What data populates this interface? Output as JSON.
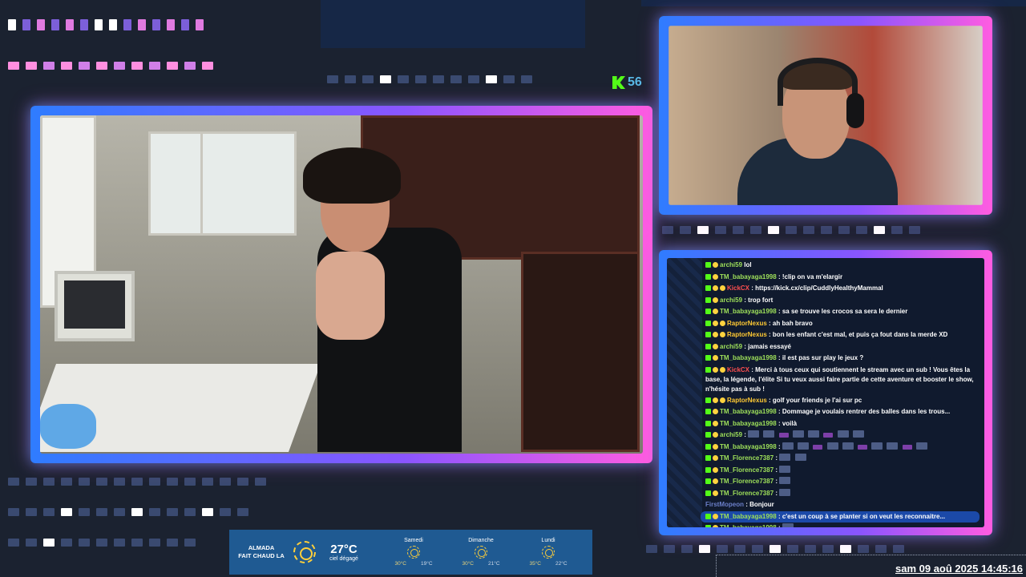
{
  "viewers": {
    "platform_icon": "kick-logo-icon",
    "count": "56"
  },
  "chat": {
    "messages": [
      {
        "user": "archi59",
        "color": "#9ee05a",
        "text": "lol",
        "badges": [
          "k",
          "s"
        ]
      },
      {
        "user": "TM_babayaga1998",
        "color": "#9ee05a",
        "text": ": !clip on va m'elargir",
        "badges": [
          "k",
          "s"
        ]
      },
      {
        "user": "KickCX",
        "color": "#ff4f4f",
        "text": ": https://kick.cx/clip/CuddlyHealthyMammal",
        "badges": [
          "k",
          "s",
          "s"
        ]
      },
      {
        "user": "archi59",
        "color": "#9ee05a",
        "text": ": trop fort",
        "badges": [
          "k",
          "s"
        ]
      },
      {
        "user": "TM_babayaga1998",
        "color": "#9ee05a",
        "text": ": sa se trouve les crocos sa sera le dernier",
        "badges": [
          "k",
          "s"
        ]
      },
      {
        "user": "RaptorNexus",
        "color": "#ffc933",
        "text": ": ah bah bravo",
        "badges": [
          "k",
          "s",
          "s"
        ]
      },
      {
        "user": "RaptorNexus",
        "color": "#ffc933",
        "text": ": bon les enfant c'est mal, et puis ça fout dans la merde XD",
        "badges": [
          "k",
          "s",
          "s"
        ]
      },
      {
        "user": "archi59",
        "color": "#9ee05a",
        "text": ": jamais essayé",
        "badges": [
          "k",
          "s"
        ]
      },
      {
        "user": "TM_babayaga1998",
        "color": "#9ee05a",
        "text": ": il est pas sur play le jeux ?",
        "badges": [
          "k",
          "s"
        ]
      },
      {
        "user": "KickCX",
        "color": "#ff4f4f",
        "text": ": Merci à tous ceux qui soutiennent le stream avec un sub ! Vous êtes la base, la légende, l'élite Si tu veux aussi faire partie de cette aventure et booster le show, n'hésite pas à sub !",
        "badges": [
          "k",
          "s",
          "s"
        ],
        "wrap": true
      },
      {
        "user": "RaptorNexus",
        "color": "#ffc933",
        "text": ": golf your friends je l'ai sur pc",
        "badges": [
          "k",
          "s",
          "s"
        ]
      },
      {
        "user": "TM_babayaga1998",
        "color": "#9ee05a",
        "text": ": Dommage je voulais rentrer des balles dans les trous...",
        "badges": [
          "k",
          "s"
        ]
      },
      {
        "user": "TM_babayaga1998",
        "color": "#9ee05a",
        "text": ": voilà",
        "badges": [
          "k",
          "s"
        ]
      },
      {
        "user": "archi59",
        "color": "#9ee05a",
        "text": ":",
        "badges": [
          "k",
          "s"
        ],
        "emotes": 8
      },
      {
        "user": "TM_babayaga1998",
        "color": "#9ee05a",
        "text": ":",
        "badges": [
          "k",
          "s"
        ],
        "emotes": 10
      },
      {
        "user": "TM_Florence7387",
        "color": "#9ee05a",
        "text": ":",
        "badges": [
          "k",
          "s"
        ],
        "emotes": 2
      },
      {
        "user": "TM_Florence7387",
        "color": "#9ee05a",
        "text": ":",
        "badges": [
          "k",
          "s"
        ],
        "emotes": 1
      },
      {
        "user": "TM_Florence7387",
        "color": "#9ee05a",
        "text": ":",
        "badges": [
          "k",
          "s"
        ],
        "emotes": 1
      },
      {
        "user": "TM_Florence7387",
        "color": "#9ee05a",
        "text": ":",
        "badges": [
          "k",
          "s"
        ],
        "emotes": 1
      },
      {
        "user": "FirstMopeon",
        "color": "#6b7fc9",
        "text": ": Bonjour",
        "badges": []
      },
      {
        "user": "TM_babayaga1998",
        "color": "#9ee05a",
        "text": ": c'est un coup à se planter si on veut les reconnaitre...",
        "badges": [
          "k",
          "s"
        ],
        "highlight": true
      },
      {
        "user": "TM_babayaga1998",
        "color": "#9ee05a",
        "text": ":",
        "badges": [
          "k",
          "s"
        ],
        "emotes": 1
      }
    ]
  },
  "weather": {
    "city": "ALMADA",
    "tagline": "FAIT CHAUD LA",
    "icon": "sun-icon",
    "temp": "27°C",
    "desc": "ciel dégagé",
    "forecast": [
      {
        "day": "Samedi",
        "high": "30°C",
        "low": "19°C"
      },
      {
        "day": "Dimanche",
        "high": "30°C",
        "low": "21°C"
      },
      {
        "day": "Lundi",
        "high": "35°C",
        "low": "22°C"
      }
    ]
  },
  "clock": {
    "text": "sam 09 aoû 2025 14:45:16"
  },
  "colors": {
    "kick_green": "#53fc18",
    "frame_blue": "#2f7cff",
    "frame_pink": "#ff5ce1"
  }
}
